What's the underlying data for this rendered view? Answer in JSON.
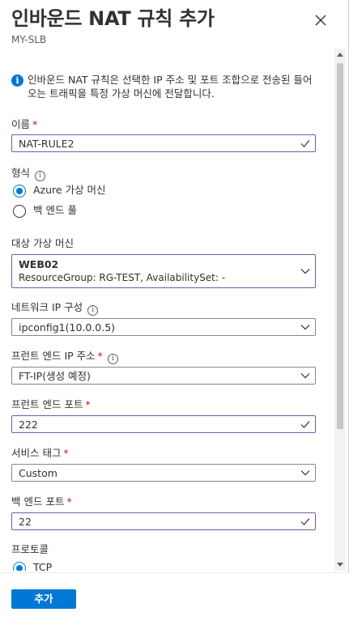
{
  "header": {
    "title": "인바운드 NAT 규칙 추가",
    "subtitle": "MY-SLB"
  },
  "info": {
    "text": "인바운드 NAT 규칙은 선택한 IP 주소 및 포트 조합으로 전송된 들어오는 트래픽을 특정 가상 머신에 전달합니다."
  },
  "name": {
    "label": "이름",
    "value": "NAT-RULE2"
  },
  "type": {
    "label": "형식",
    "options": [
      "Azure 가상 머신",
      "백 엔드 풀"
    ],
    "selected": 0
  },
  "target_vm": {
    "label": "대상 가상 머신",
    "value": "WEB02",
    "detail": "ResourceGroup: RG-TEST, AvailabilitySet: -"
  },
  "network_ip": {
    "label": "네트워크 IP 구성",
    "value": "ipconfig1(10.0.0.5)"
  },
  "frontend_ip": {
    "label": "프런트 엔드 IP 주소",
    "value": "FT-IP(생성 예정)"
  },
  "frontend_port": {
    "label": "프런트 엔드 포트",
    "value": "222"
  },
  "service_tag": {
    "label": "서비스 태그",
    "value": "Custom"
  },
  "backend_port": {
    "label": "백 엔드 포트",
    "value": "22"
  },
  "protocol": {
    "label": "프로토콜",
    "options": [
      "TCP"
    ],
    "selected": 0
  },
  "footer": {
    "add_label": "추가"
  },
  "colors": {
    "accent": "#0078d4",
    "required": "#a4262c",
    "focus_border": "#7a58a6"
  }
}
